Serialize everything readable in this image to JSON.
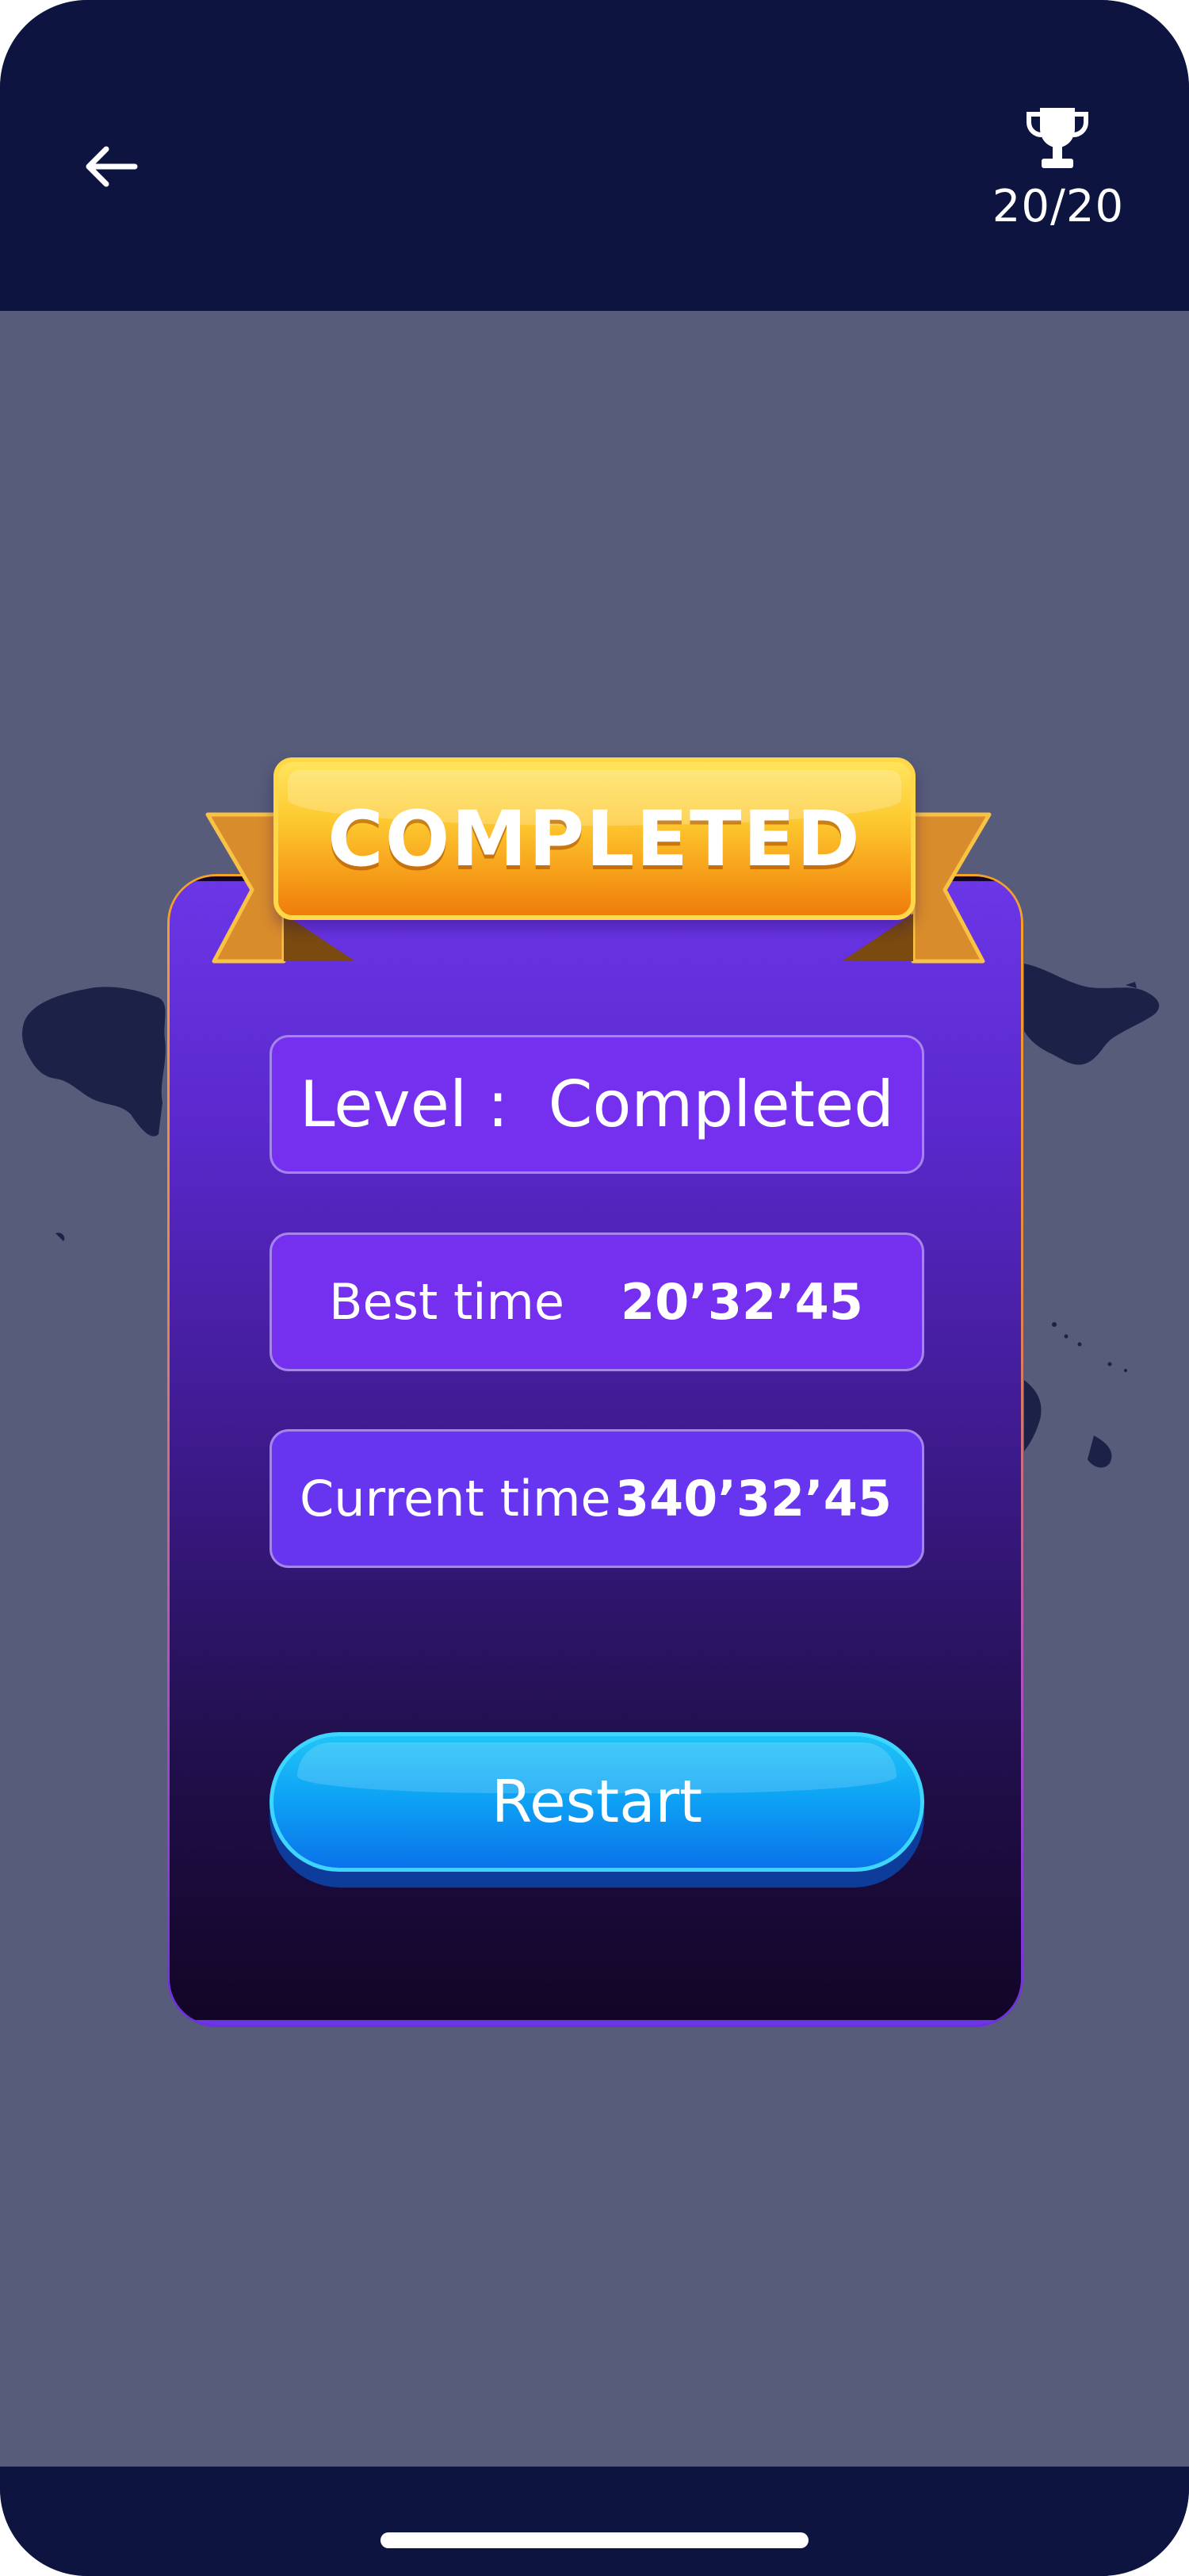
{
  "header": {
    "back_icon": "arrow-left-icon",
    "trophy_icon": "trophy-icon",
    "score": "20/20"
  },
  "dialog": {
    "banner": "COMPLETED",
    "level": {
      "label": "Level :",
      "value": "Completed"
    },
    "best_time": {
      "label": "Best time",
      "value": "20’32’45"
    },
    "current_time": {
      "label": "Current time",
      "value": "340’32’45"
    },
    "restart_label": "Restart"
  },
  "colors": {
    "header_bg": "#0d1440",
    "page_bg": "#565c7a",
    "card_top": "#6b36e6",
    "card_bottom": "#120526",
    "banner": "#fdc930",
    "button": "#0ea4f5"
  }
}
